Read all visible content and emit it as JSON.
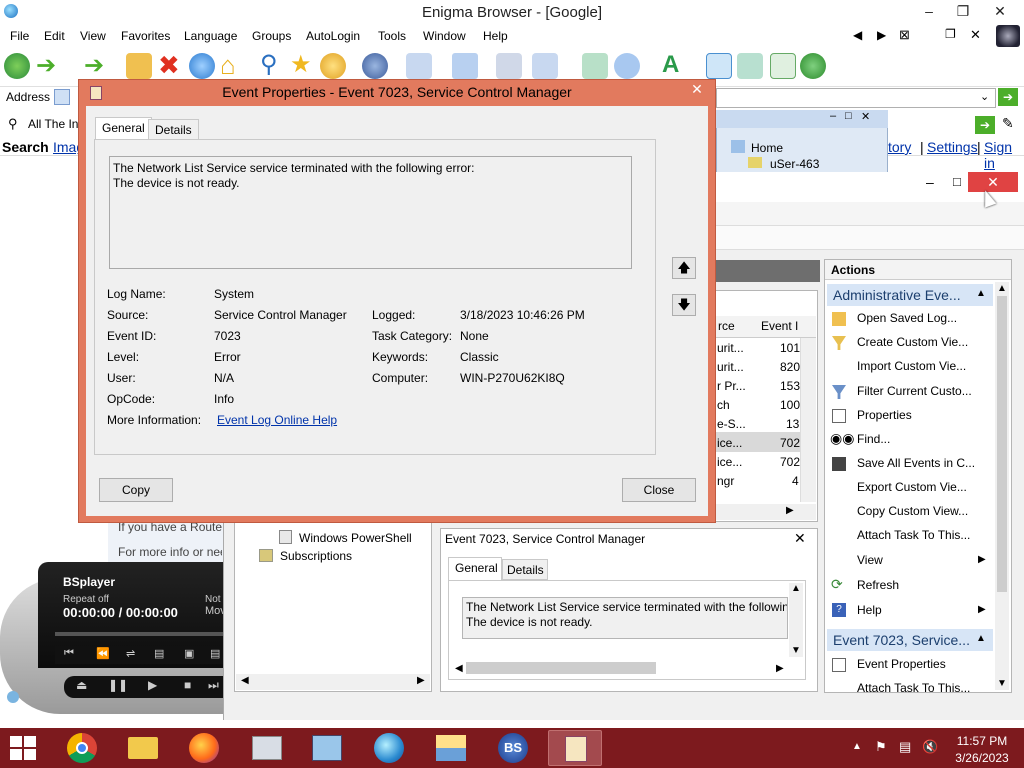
{
  "browser": {
    "title": "Enigma Browser - [Google]",
    "menu": [
      "File",
      "Edit",
      "View",
      "Favorites",
      "Language",
      "Groups",
      "AutoLogin",
      "Tools",
      "Window",
      "Help"
    ],
    "address_label": "Address",
    "link_fragment": "All The In",
    "search_label": "Search",
    "images_fragment": "Imag",
    "top_links": [
      "tory",
      "Settings",
      "Sign in"
    ]
  },
  "home_panel": {
    "home": "Home",
    "user": "uSer-463"
  },
  "event_viewer": {
    "list_header_source": "rce",
    "list_header_event": "Event I",
    "rows": [
      {
        "src": "urit...",
        "id": "101"
      },
      {
        "src": "urit...",
        "id": "820"
      },
      {
        "src": "r Pr...",
        "id": "153"
      },
      {
        "src": "ch",
        "id": "100"
      },
      {
        "src": "e-S...",
        "id": "13"
      },
      {
        "src": "ice...",
        "id": "702"
      },
      {
        "src": "ice...",
        "id": "702"
      },
      {
        "src": "ngr",
        "id": "4"
      }
    ],
    "tree_items": [
      "Windows PowerShell",
      "Subscriptions"
    ],
    "left_text": [
      "If you have a Router/",
      "For more info or need"
    ],
    "preview_title": "Event 7023, Service Control Manager",
    "preview_tabs": [
      "General",
      "Details"
    ],
    "preview_text": "The Network List Service service terminated with the followin\nThe device is not ready.",
    "actions_title": "Actions",
    "section1": "Administrative Eve...",
    "actions1": [
      "Open Saved Log...",
      "Create Custom Vie...",
      "Import Custom Vie...",
      "Filter Current Custo...",
      "Properties",
      "Find...",
      "Save All Events in C...",
      "Export Custom Vie...",
      "Copy Custom View...",
      "Attach Task To This...",
      "View",
      "Refresh",
      "Help"
    ],
    "section2": "Event 7023, Service...",
    "actions2": [
      "Event Properties",
      "Attach Task To This..."
    ]
  },
  "dialog": {
    "title": "Event Properties - Event 7023, Service Control Manager",
    "tabs": [
      "General",
      "Details"
    ],
    "description": "The Network List Service service terminated with the following error:\nThe device is not ready.",
    "fields": {
      "log_name_label": "Log Name:",
      "log_name": "System",
      "source_label": "Source:",
      "source": "Service Control Manager",
      "logged_label": "Logged:",
      "logged": "3/18/2023 10:46:26 PM",
      "event_id_label": "Event ID:",
      "event_id": "7023",
      "task_category_label": "Task Category:",
      "task_category": "None",
      "level_label": "Level:",
      "level": "Error",
      "keywords_label": "Keywords:",
      "keywords": "Classic",
      "user_label": "User:",
      "user": "N/A",
      "computer_label": "Computer:",
      "computer": "WIN-P270U62KI8Q",
      "opcode_label": "OpCode:",
      "opcode": "Info",
      "more_info_label": "More Information:",
      "more_info_link": "Event Log Online Help"
    },
    "copy_button": "Copy",
    "close_button": "Close"
  },
  "bsplayer": {
    "name": "BSplayer",
    "repeat": "Repeat off",
    "time": "00:00:00 / 00:00:00",
    "side1": "Not",
    "side2": "Mov"
  },
  "taskbar": {
    "time": "11:57 PM",
    "date": "3/26/2023",
    "bs_label": "BS"
  },
  "colors": {
    "taskbar": "#7d1a1e",
    "dialog_frame": "#e27a5e",
    "close_red": "#e04343",
    "link_blue": "#0033aa"
  }
}
